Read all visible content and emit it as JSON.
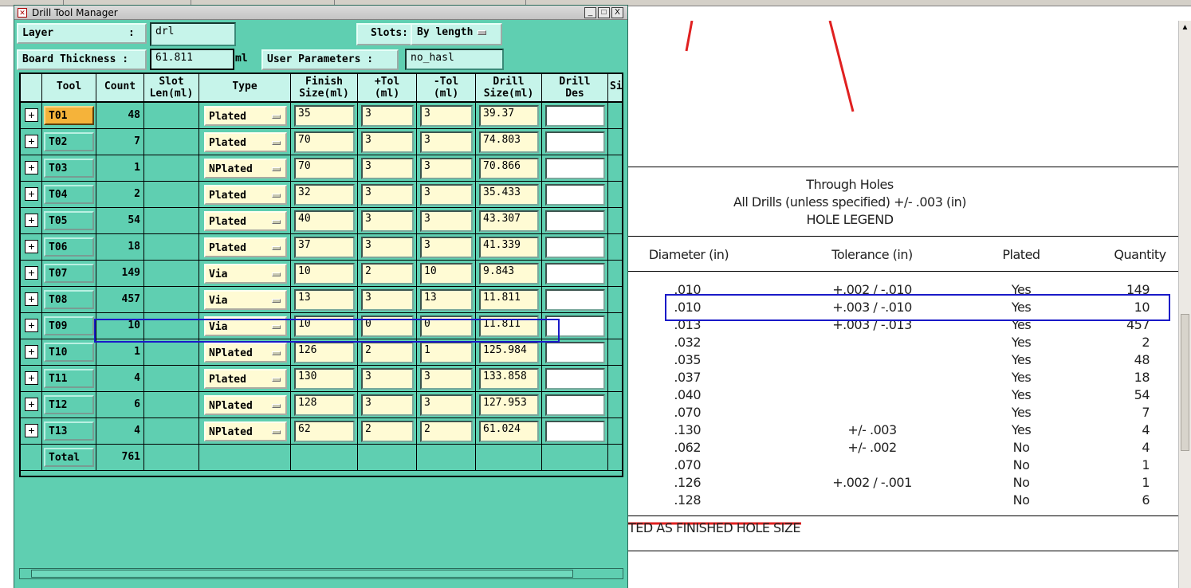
{
  "window": {
    "title": "Drill Tool Manager",
    "minimize": "_",
    "maximize": "□",
    "close": "X"
  },
  "form": {
    "layer_label": "Layer            :",
    "layer_value": "drl",
    "slots_label": "Slots:",
    "slots_value": "By length",
    "thickness_label": "Board Thickness :",
    "thickness_value": "61.811",
    "thickness_unit": "ml",
    "user_params_label": "User Parameters :",
    "user_params_value": "no_hasl"
  },
  "table": {
    "headers": {
      "tool": "Tool",
      "count": "Count",
      "slot_len_1": "Slot",
      "slot_len_2": "Len(ml)",
      "type": "Type",
      "finish_1": "Finish",
      "finish_2": "Size(ml)",
      "ptol_1": "+Tol",
      "ptol_2": "(ml)",
      "ntol_1": "-Tol",
      "ntol_2": "(ml)",
      "drill_1": "Drill",
      "drill_2": "Size(ml)",
      "des_1": "Drill",
      "des_2": "Des",
      "si": "Si"
    },
    "rows": [
      {
        "tool": "T01",
        "count": "48",
        "type": "Plated",
        "finish": "35",
        "ptol": "3",
        "ntol": "3",
        "drill": "39.37",
        "des": "",
        "active": true
      },
      {
        "tool": "T02",
        "count": "7",
        "type": "Plated",
        "finish": "70",
        "ptol": "3",
        "ntol": "3",
        "drill": "74.803",
        "des": ""
      },
      {
        "tool": "T03",
        "count": "1",
        "type": "NPlated",
        "finish": "70",
        "ptol": "3",
        "ntol": "3",
        "drill": "70.866",
        "des": ""
      },
      {
        "tool": "T04",
        "count": "2",
        "type": "Plated",
        "finish": "32",
        "ptol": "3",
        "ntol": "3",
        "drill": "35.433",
        "des": ""
      },
      {
        "tool": "T05",
        "count": "54",
        "type": "Plated",
        "finish": "40",
        "ptol": "3",
        "ntol": "3",
        "drill": "43.307",
        "des": ""
      },
      {
        "tool": "T06",
        "count": "18",
        "type": "Plated",
        "finish": "37",
        "ptol": "3",
        "ntol": "3",
        "drill": "41.339",
        "des": ""
      },
      {
        "tool": "T07",
        "count": "149",
        "type": "Via",
        "finish": "10",
        "ptol": "2",
        "ntol": "10",
        "drill": "9.843",
        "des": ""
      },
      {
        "tool": "T08",
        "count": "457",
        "type": "Via",
        "finish": "13",
        "ptol": "3",
        "ntol": "13",
        "drill": "11.811",
        "des": ""
      },
      {
        "tool": "T09",
        "count": "10",
        "type": "Via",
        "finish": "10",
        "ptol": "0",
        "ntol": "0",
        "drill": "11.811",
        "des": ""
      },
      {
        "tool": "T10",
        "count": "1",
        "type": "NPlated",
        "finish": "126",
        "ptol": "2",
        "ntol": "1",
        "drill": "125.984",
        "des": ""
      },
      {
        "tool": "T11",
        "count": "4",
        "type": "Plated",
        "finish": "130",
        "ptol": "3",
        "ntol": "3",
        "drill": "133.858",
        "des": ""
      },
      {
        "tool": "T12",
        "count": "6",
        "type": "NPlated",
        "finish": "128",
        "ptol": "3",
        "ntol": "3",
        "drill": "127.953",
        "des": ""
      },
      {
        "tool": "T13",
        "count": "4",
        "type": "NPlated",
        "finish": "62",
        "ptol": "2",
        "ntol": "2",
        "drill": "61.024",
        "des": ""
      }
    ],
    "total_label": "Total",
    "total_count": "761"
  },
  "legend": {
    "title1": "Through Holes",
    "title2": "All Drills (unless specified) +/- .003 (in)",
    "title3": "HOLE LEGEND",
    "headers": [
      "Diameter (in)",
      "Tolerance (in)",
      "Plated",
      "Quantity"
    ],
    "rows": [
      {
        "dia": ".010",
        "tol": "+.002 / -.010",
        "plated": "Yes",
        "qty": "149"
      },
      {
        "dia": ".010",
        "tol": "+.003 / -.010",
        "plated": "Yes",
        "qty": "10"
      },
      {
        "dia": ".013",
        "tol": "+.003 / -.013",
        "plated": "Yes",
        "qty": "457"
      },
      {
        "dia": ".032",
        "tol": "",
        "plated": "Yes",
        "qty": "2"
      },
      {
        "dia": ".035",
        "tol": "",
        "plated": "Yes",
        "qty": "48"
      },
      {
        "dia": ".037",
        "tol": "",
        "plated": "Yes",
        "qty": "18"
      },
      {
        "dia": ".040",
        "tol": "",
        "plated": "Yes",
        "qty": "54"
      },
      {
        "dia": ".070",
        "tol": "",
        "plated": "Yes",
        "qty": "7"
      },
      {
        "dia": ".130",
        "tol": "+/- .003",
        "plated": "Yes",
        "qty": "4"
      },
      {
        "dia": ".062",
        "tol": "+/- .002",
        "plated": "No",
        "qty": "4"
      },
      {
        "dia": ".070",
        "tol": "",
        "plated": "No",
        "qty": "1"
      },
      {
        "dia": ".126",
        "tol": "+.002 / -.001",
        "plated": "No",
        "qty": "1"
      },
      {
        "dia": ".128",
        "tol": "",
        "plated": "No",
        "qty": "6"
      }
    ],
    "note": "TED AS FINISHED HOLE SIZE"
  },
  "colors": {
    "window_bg": "#5fcfb1",
    "field_bg": "#c6f4ea",
    "edit_bg": "#fffbd4",
    "active_tool": "#f5b33a",
    "highlight": "#1a1ac8",
    "red_line": "#e02020"
  }
}
